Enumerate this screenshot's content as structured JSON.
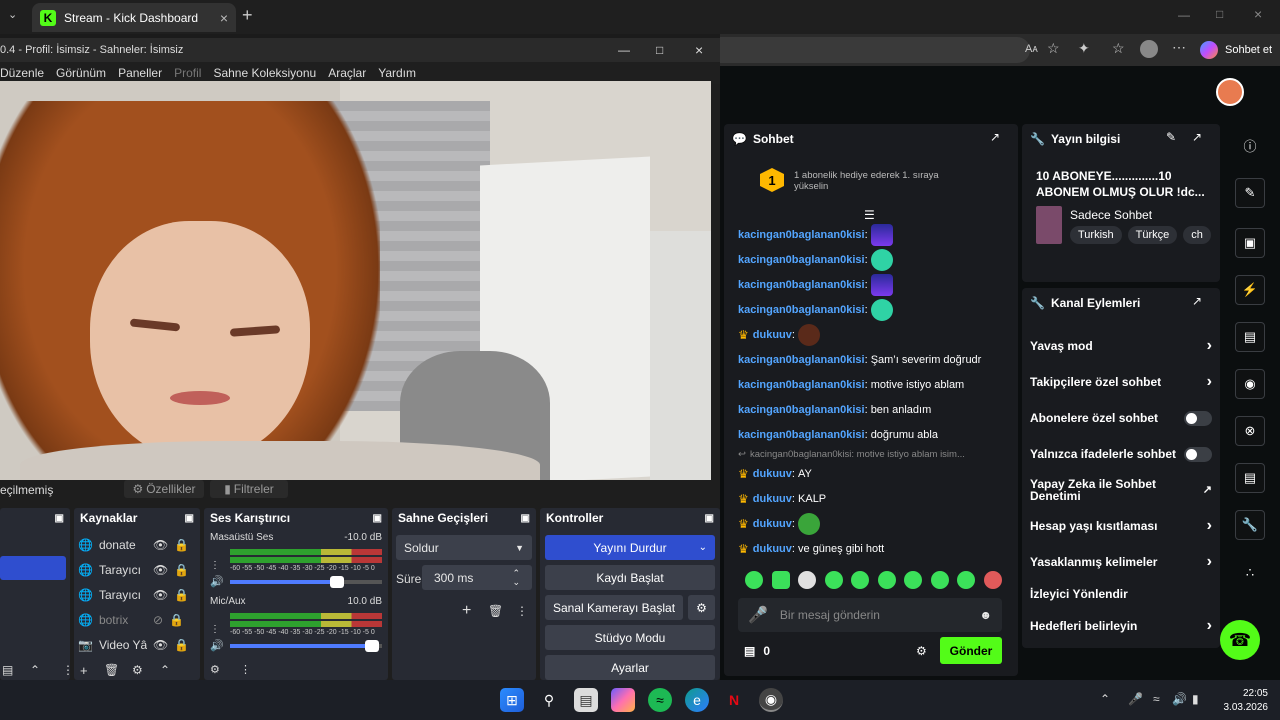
{
  "browser": {
    "tab_title": "Stream - Kick Dashboard",
    "new_tab": "+",
    "sohbet_et": "Sohbet et",
    "reader": "Aᴀ"
  },
  "obs": {
    "title": "0.4 - Profil: İsimsiz - Sahneler: İsimsiz",
    "menu": [
      "Düzenle",
      "Görünüm",
      "Paneller",
      "Profil",
      "Sahne Koleksiyonu",
      "Araçlar",
      "Yardım"
    ],
    "selection_label": "eçilmemiş",
    "properties_btn": "Özellikler",
    "filters_btn": "Filtreler",
    "sources_title": "Kaynaklar",
    "sources": [
      {
        "name": "donate"
      },
      {
        "name": "Tarayıcı"
      },
      {
        "name": "Tarayıcı"
      },
      {
        "name": "botrix"
      },
      {
        "name": "Video Yâ"
      }
    ],
    "mixer_title": "Ses Karıştırıcı",
    "mixer": [
      {
        "name": "Masaüstü Ses",
        "db": "-10.0 dB",
        "level": 0.75
      },
      {
        "name": "Mic/Aux",
        "db": "10.0 dB",
        "level": 0.98
      }
    ],
    "meter_scale": "-60 -55 -50 -45 -40 -35 -30 -25 -20 -15 -10 -5 0",
    "transitions_title": "Sahne Geçişleri",
    "transition_value": "Soldur",
    "duration_label": "Süre",
    "duration_value": "300 ms",
    "controls_title": "Kontroller",
    "controls": {
      "stop_stream": "Yayını Durdur",
      "start_rec": "Kaydı Başlat",
      "virtual_cam": "Sanal Kamerayı Başlat",
      "studio": "Stüdyo Modu",
      "settings": "Ayarlar"
    }
  },
  "chat": {
    "title": "Sohbet",
    "gift_rank": "1",
    "gift_text": "1 abonelik hediye ederek 1. sıraya yükselin",
    "messages": [
      {
        "user": "kacingan0baglanan0kisi",
        "text": ""
      },
      {
        "user": "kacingan0baglanan0kisi",
        "text": ""
      },
      {
        "user": "kacingan0baglanan0kisi",
        "text": ""
      },
      {
        "user": "kacingan0baglanan0kisi",
        "text": ""
      },
      {
        "user": "dukuuv",
        "text": ""
      },
      {
        "user": "kacingan0baglanan0kisi",
        "text": "Şam’ı severim doğrudr"
      },
      {
        "user": "kacingan0baglanan0kisi",
        "text": "motive istiyo ablam"
      },
      {
        "user": "kacingan0baglanan0kisi",
        "text": "ben anladım"
      },
      {
        "user": "kacingan0baglanan0kisi",
        "text": "doğrumu abla"
      },
      {
        "user": "dukuuv",
        "text": "AY"
      },
      {
        "user": "dukuuv",
        "text": "KALP"
      },
      {
        "user": "dukuuv",
        "text": ""
      },
      {
        "user": "dukuuv",
        "text": "ve güneş gibi hott"
      }
    ],
    "reply_preview": "kacingan0baglanan0kisi: motive istiyo ablam isim...",
    "input_placeholder": "Bir mesaj gönderin",
    "points": "0",
    "send": "Gönder"
  },
  "stream_info": {
    "title": "Yayın bilgisi",
    "stream_title": "10 ABONEYE..............10 ABONEM OLMUŞ OLUR !dc...",
    "category": "Sadece Sohbet",
    "tags": [
      "Turkish",
      "Türkçe",
      "ch"
    ]
  },
  "channel_actions": {
    "title": "Kanal Eylemleri",
    "items": [
      {
        "label": "Yavaş mod",
        "kind": "chevron"
      },
      {
        "label": "Takipçilere özel sohbet",
        "kind": "chevron"
      },
      {
        "label": "Abonelere özel sohbet",
        "kind": "toggle"
      },
      {
        "label": "Yalnızca ifadelerle sohbet",
        "kind": "toggle"
      },
      {
        "label": "Yapay Zeka ile Sohbet Denetimi",
        "kind": "external"
      },
      {
        "label": "Hesap yaşı kısıtlaması",
        "kind": "chevron"
      },
      {
        "label": "Yasaklanmış kelimeler",
        "kind": "chevron"
      },
      {
        "label": "İzleyici Yönlendir",
        "kind": "none"
      },
      {
        "label": "Hedefleri belirleyin",
        "kind": "chevron"
      }
    ]
  },
  "taskbar": {
    "time": "22:05",
    "date": "3.03.2026"
  },
  "colors": {
    "kick_green": "#53fc18",
    "obs_blue": "#2f4ecf",
    "username_blue": "#53a5ff",
    "crown": "#ffb800"
  }
}
